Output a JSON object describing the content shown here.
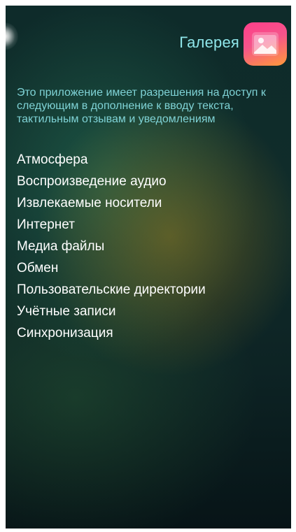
{
  "header": {
    "app_title": "Галерея",
    "app_icon": "gallery-image-icon"
  },
  "description": "Это приложение имеет разрешения на доступ к следующим в дополнение к вводу текста, тактильным отзывам и уведомлениям",
  "permissions": [
    "Атмосфера",
    "Воспроизведение аудио",
    "Извлекаемые носители",
    "Интернет",
    "Медиа файлы",
    "Обмен",
    "Пользовательские директории",
    "Учётные записи",
    "Синхронизация"
  ],
  "colors": {
    "title": "#8fe6ea",
    "description": "#7fd3d6",
    "permission_text": "#ffffff",
    "icon_gradient_start": "#ff3f8a",
    "icon_gradient_end": "#ff9a3a"
  }
}
